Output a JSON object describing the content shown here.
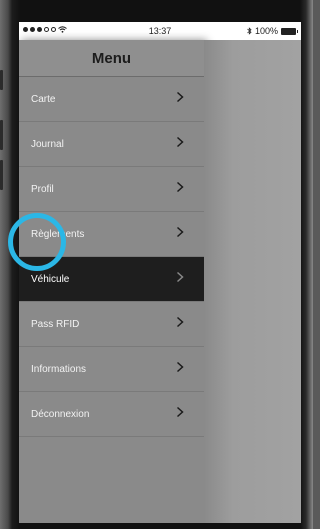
{
  "status_bar": {
    "time": "13:37",
    "battery": "100%"
  },
  "menu": {
    "title": "Menu",
    "items": [
      {
        "label": "Carte"
      },
      {
        "label": "Journal"
      },
      {
        "label": "Profil"
      },
      {
        "label": "Règlements"
      },
      {
        "label": "Véhicule",
        "active": true
      },
      {
        "label": "Pass RFID"
      },
      {
        "label": "Informations"
      },
      {
        "label": "Déconnexion"
      }
    ]
  },
  "colors": {
    "highlight": "#2bb7e6",
    "active_bg": "#1e1e1e",
    "panel_bg": "#8a8a8a"
  },
  "icons": {
    "chevron": "chevron-right-icon",
    "wifi": "wifi-icon",
    "bluetooth": "bluetooth-icon",
    "battery": "battery-icon"
  }
}
